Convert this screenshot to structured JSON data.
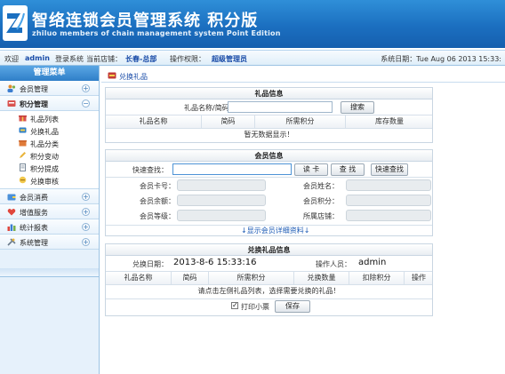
{
  "header": {
    "title": "智络连锁会员管理系统  积分版",
    "subtitle": "zhiluo members of chain management system    Point Edition"
  },
  "infobar": {
    "welcome": "欢迎",
    "username": "admin",
    "login_system": "登录系统",
    "current_store_label": "当前店铺：",
    "current_store": "长春-总部",
    "permission_label": "操作权限：",
    "permission": "超级管理员",
    "system_date": "系统日期：Tue Aug 06 2013 15:33:"
  },
  "sidebar": {
    "heading": "管理菜单",
    "groups": [
      {
        "label": "会员管理",
        "toggle": "+"
      },
      {
        "label": "积分管理",
        "toggle": "−"
      },
      {
        "label": "会员消费",
        "toggle": "+"
      },
      {
        "label": "增值服务",
        "toggle": "+"
      },
      {
        "label": "统计报表",
        "toggle": "+"
      },
      {
        "label": "系统管理",
        "toggle": "+"
      }
    ],
    "sub_items": [
      "礼品列表",
      "兑换礼品",
      "礼品分类",
      "积分变动",
      "积分提成",
      "兑换审核"
    ]
  },
  "breadcrumb": {
    "label": "兑换礼品"
  },
  "gift_info": {
    "title": "礼品信息",
    "search_label": "礼品名称/简码:",
    "search_value": "",
    "search_button": "搜索",
    "columns": [
      "礼品名称",
      "简码",
      "所需积分",
      "库存数量"
    ],
    "empty_text": "暂无数据显示！"
  },
  "member_info": {
    "title": "会员信息",
    "quick_search_label": "快速查找：",
    "quick_search_value": "",
    "read_card_button": "读  卡",
    "find_button": "查  找",
    "quick_find_button": "快速查找",
    "fields": {
      "card_no": "会员卡号：",
      "name": "会员姓名：",
      "balance": "会员余额：",
      "points": "会员积分：",
      "level": "会员等级：",
      "store": "所属店铺："
    },
    "show_details_link": "↓显示会员详细资料↓"
  },
  "exchange_info": {
    "title": "兑换礼品信息",
    "date_label": "兑换日期：",
    "date_value": "2013-8-6 15:33:16",
    "operator_label": "操作人员：",
    "operator_value": "admin",
    "columns": [
      "礼品名称",
      "简码",
      "所需积分",
      "兑换数量",
      "扣除积分",
      "操作"
    ],
    "hint_text": "请点击左侧礼品列表，选择需要兑换的礼品！",
    "print_receipt_label": "打印小票",
    "print_receipt_checked": true,
    "save_button": "保存"
  },
  "colors": {
    "header_blue": "#1b6fc0",
    "link_blue": "#1d5bb5",
    "sidebar_bg": "#e6f1fb"
  }
}
